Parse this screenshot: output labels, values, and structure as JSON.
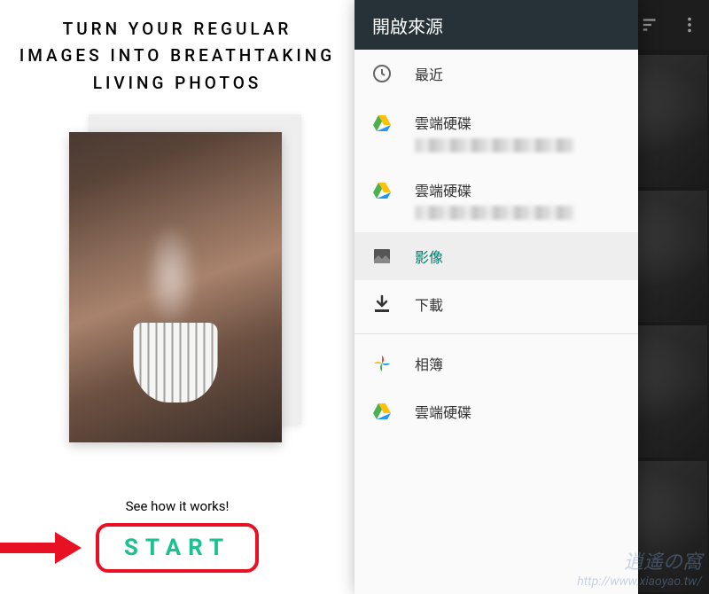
{
  "left": {
    "tagline": "TURN YOUR REGULAR IMAGES INTO BREATHTAKING LIVING PHOTOS",
    "hint": "See how it works!",
    "start_label": "START"
  },
  "right": {
    "drawer_title": "開啟來源",
    "items": [
      {
        "icon": "recent",
        "label": "最近"
      },
      {
        "icon": "drive",
        "label": "雲端硬碟"
      },
      {
        "icon": "drive",
        "label": "雲端硬碟"
      },
      {
        "icon": "image",
        "label": "影像",
        "selected": true
      },
      {
        "icon": "download",
        "label": "下載"
      },
      {
        "icon": "photos",
        "label": "相簿"
      },
      {
        "icon": "drive",
        "label": "雲端硬碟"
      }
    ]
  },
  "watermark": {
    "cn": "逍遙の窩",
    "url": "http://www.xiaoyao.tw/"
  }
}
